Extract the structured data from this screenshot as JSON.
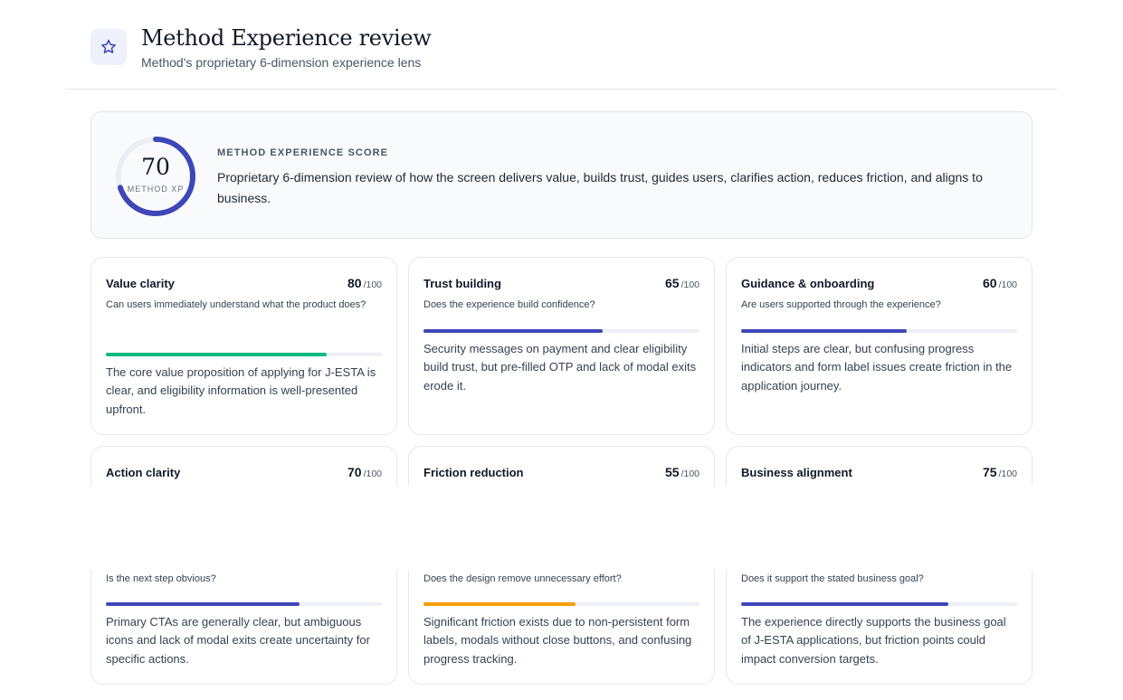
{
  "header": {
    "icon": "star-icon",
    "title": "Method Experience review",
    "subtitle": "Method's proprietary 6-dimension experience lens"
  },
  "score": {
    "value": "70",
    "value_fraction": 0.7,
    "gauge_label": "METHOD XP",
    "label": "METHOD EXPERIENCE SCORE",
    "description": "Proprietary 6-dimension review of how the screen delivers value, builds trust, guides users, clarifies action, reduces friction, and aligns to business.",
    "accent_color": "#3f46b8",
    "track_color": "#eceef4"
  },
  "dimensions": [
    {
      "title": "Value clarity",
      "score": "80",
      "outof": "/100",
      "question": "Can users immediately understand what the product does?",
      "summary": "The core value proposition of applying for J-ESTA is clear, and eligibility information is well-presented upfront.",
      "fill": 0.8,
      "color": "#10b981"
    },
    {
      "title": "Trust building",
      "score": "65",
      "outof": "/100",
      "question": "Does the experience build confidence?",
      "summary": "Security messages on payment and clear eligibility build trust, but pre-filled OTP and lack of modal exits erode it.",
      "fill": 0.65,
      "color": "#3f46b8"
    },
    {
      "title": "Guidance & onboarding",
      "score": "60",
      "outof": "/100",
      "question": "Are users supported through the experience?",
      "summary": "Initial steps are clear, but confusing progress indicators and form label issues create friction in the application journey.",
      "fill": 0.6,
      "color": "#3f46b8"
    },
    {
      "title": "Action clarity",
      "score": "70",
      "outof": "/100",
      "question": "Is the next step obvious?",
      "summary": "Primary CTAs are generally clear, but ambiguous icons and lack of modal exits create uncertainty for specific actions.",
      "fill": 0.7,
      "color": "#3f46b8"
    },
    {
      "title": "Friction reduction",
      "score": "55",
      "outof": "/100",
      "question": "Does the design remove unnecessary effort?",
      "summary": "Significant friction exists due to non-persistent form labels, modals without close buttons, and confusing progress tracking.",
      "fill": 0.55,
      "color": "#f59e0b"
    },
    {
      "title": "Business alignment",
      "score": "75",
      "outof": "/100",
      "question": "Does it support the stated business goal?",
      "summary": "The experience directly supports the business goal of J-ESTA applications, but friction points could impact conversion targets.",
      "fill": 0.75,
      "color": "#3f46b8"
    }
  ]
}
